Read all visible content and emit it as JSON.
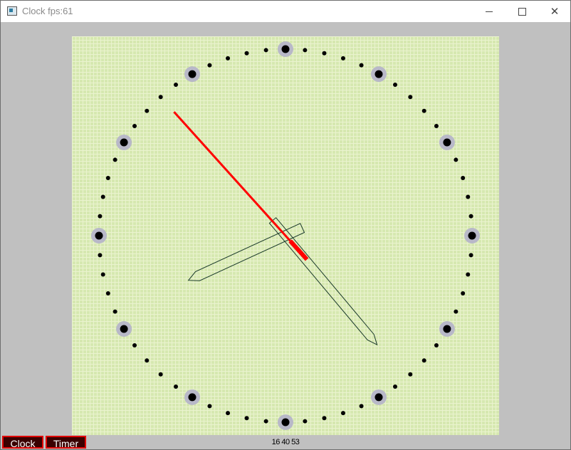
{
  "window": {
    "title": "Clock fps:61",
    "controls": {
      "minimize": "minimize-icon",
      "maximize": "maximize-icon",
      "close": "close-icon",
      "close_glyph": "✕"
    }
  },
  "clock": {
    "time_readout": "16 40 53",
    "hours": 16,
    "minutes": 40,
    "seconds": 53,
    "face_color": "#d6e8b0",
    "grid_color": "#eaf3cf",
    "marker_color": "#000000",
    "halo_color": "#b8b8c8",
    "hand_outline_color": "#1a3a2a",
    "second_hand_color": "#ff0000"
  },
  "tabs": [
    {
      "label": "Clock"
    },
    {
      "label": "Timer"
    }
  ]
}
